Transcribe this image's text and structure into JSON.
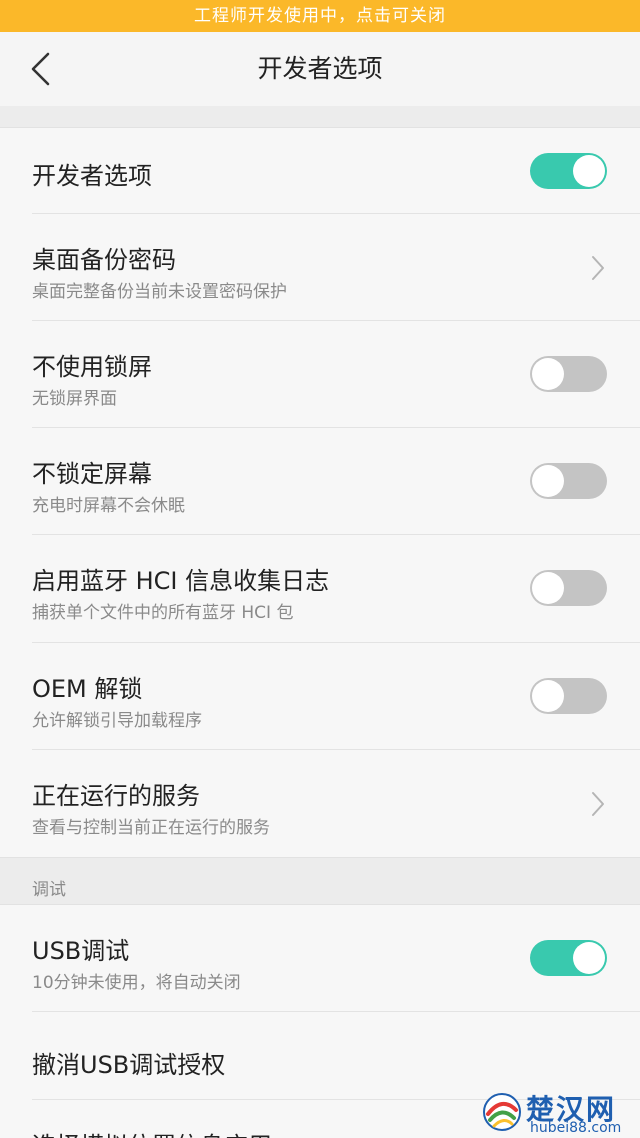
{
  "banner": {
    "text": "工程师开发使用中，点击可关闭"
  },
  "header": {
    "title": "开发者选项"
  },
  "rows": [
    {
      "title": "开发者选项",
      "toggle": true
    },
    {
      "title": "桌面备份密码",
      "subtitle": "桌面完整备份当前未设置密码保护",
      "chevron": true
    },
    {
      "title": "不使用锁屏",
      "subtitle": "无锁屏界面",
      "toggle": false
    },
    {
      "title": "不锁定屏幕",
      "subtitle": "充电时屏幕不会休眠",
      "toggle": false
    },
    {
      "title": "启用蓝牙 HCI 信息收集日志",
      "subtitle": "捕获单个文件中的所有蓝牙 HCI 包",
      "toggle": false
    },
    {
      "title": "OEM 解锁",
      "subtitle": "允许解锁引导加载程序",
      "toggle": false
    },
    {
      "title": "正在运行的服务",
      "subtitle": "查看与控制当前正在运行的服务",
      "chevron": true
    }
  ],
  "debug_section": {
    "label": "调试",
    "rows": [
      {
        "title": "USB调试",
        "subtitle": "10分钟未使用，将自动关闭",
        "toggle": true
      },
      {
        "title": "撤消USB调试授权"
      },
      {
        "title": "选择模拟位置信息应用"
      }
    ]
  },
  "watermark": {
    "name": "楚汉网",
    "domain": "hubei88.com"
  },
  "colors": {
    "banner": "#fbb829",
    "toggle_on": "#39c9ae",
    "toggle_off": "#c4c4c4",
    "watermark": "#1f5fb0"
  }
}
